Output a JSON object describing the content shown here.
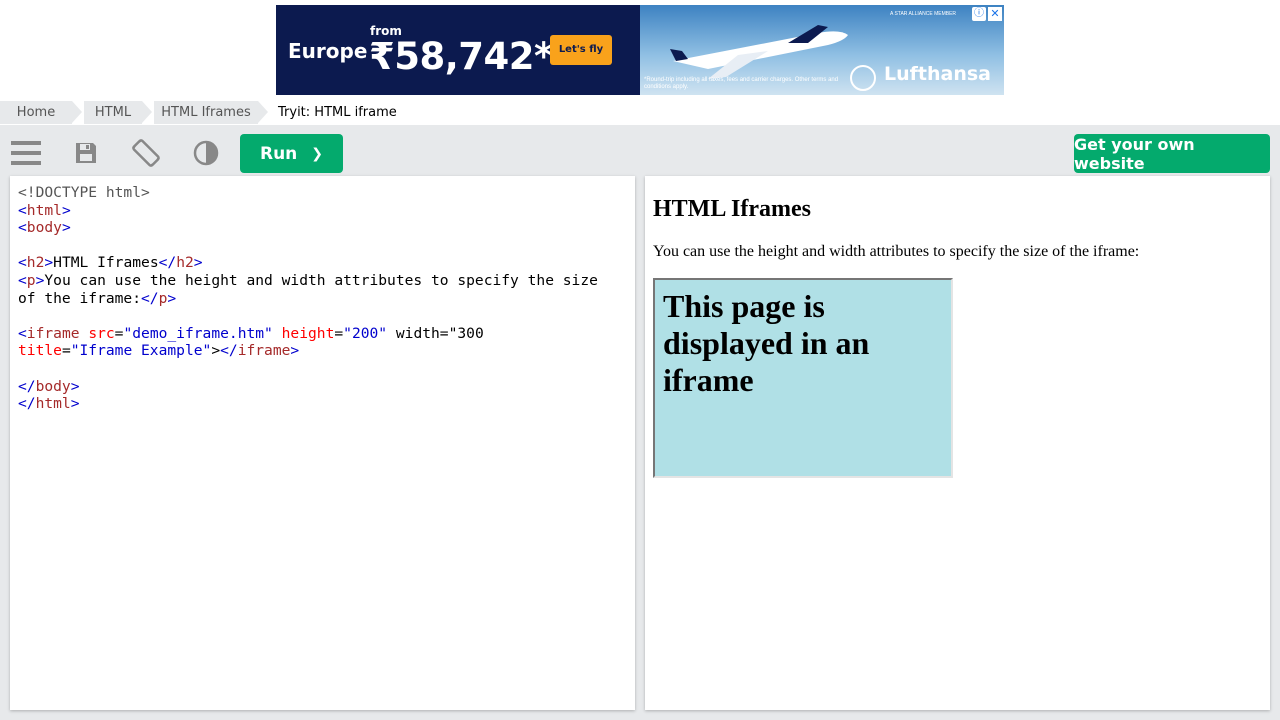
{
  "ad": {
    "destination": "Europe",
    "from_label": "from",
    "price": "₹58,742*",
    "cta": "Let's fly",
    "alliance": "A STAR ALLIANCE MEMBER",
    "terms": "*Round-trip including all taxes, fees and carrier charges. Other terms and conditions apply.",
    "brand": "Lufthansa",
    "info_icon": "ⓘ",
    "close_icon": "✕"
  },
  "breadcrumb": {
    "items": [
      "Home",
      "HTML",
      "HTML Iframes"
    ],
    "current": "Tryit: HTML iframe"
  },
  "toolbar": {
    "run_label": "Run",
    "run_chevron": "❯",
    "own_website_label": "Get your own website",
    "icons": [
      "menu-icon",
      "save-icon",
      "rotate-icon",
      "contrast-icon"
    ]
  },
  "code": {
    "lines": [
      "<!DOCTYPE html>",
      "<html>",
      "<body>",
      "",
      "<h2>HTML Iframes</h2>",
      "<p>You can use the height and width attributes to specify the size",
      "of the iframe:</p>",
      "",
      "<iframe src=\"demo_iframe.htm\" height=\"200\" width=\"300\"",
      "title=\"Iframe Example\"></iframe>",
      "",
      "</body>",
      "</html>"
    ]
  },
  "result": {
    "heading": "HTML Iframes",
    "paragraph": "You can use the height and width attributes to specify the size of the iframe:",
    "iframe_heading": "This page is displayed in an iframe"
  },
  "colors": {
    "accent": "#04aa6d",
    "iframe_bg": "#b0e0e6",
    "tag": "#a52a2a",
    "bracket": "#0000cd",
    "attribute": "#ff0000",
    "value": "#0000cd"
  }
}
